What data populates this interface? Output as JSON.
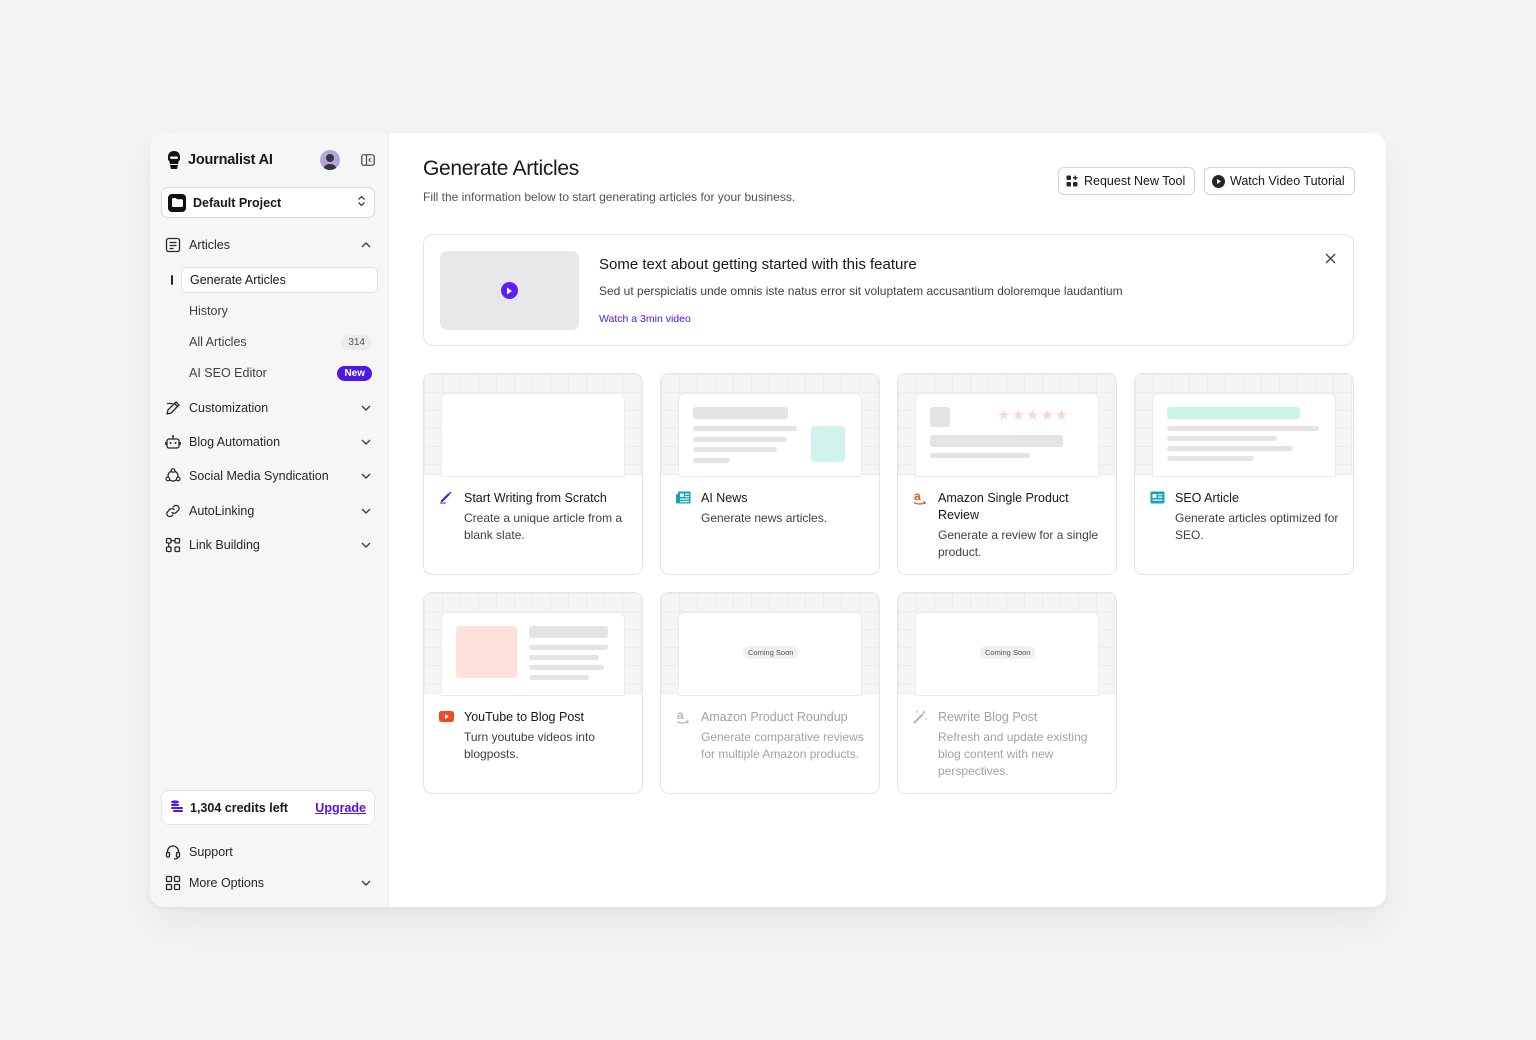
{
  "app": {
    "name": "Journalist AI"
  },
  "project": {
    "selected": "Default Project"
  },
  "sidebar": {
    "articles": {
      "label": "Articles",
      "items": [
        {
          "label": "Generate Articles"
        },
        {
          "label": "History"
        },
        {
          "label": "All Articles",
          "count": "314"
        },
        {
          "label": "AI SEO Editor",
          "badge": "New"
        }
      ]
    },
    "sections": [
      {
        "label": "Customization",
        "icon": "pen-tool-icon"
      },
      {
        "label": "Blog Automation",
        "icon": "robot-icon"
      },
      {
        "label": "Social Media Syndication",
        "icon": "share-icon"
      },
      {
        "label": "AutoLinking",
        "icon": "link-icon"
      },
      {
        "label": "Link Building",
        "icon": "nodes-icon"
      }
    ],
    "credits": {
      "text": "1,304 credits left",
      "upgrade": "Upgrade"
    },
    "footer": [
      {
        "label": "Support",
        "icon": "headset-icon"
      },
      {
        "label": "More Options",
        "icon": "grid-icon"
      }
    ]
  },
  "header": {
    "title": "Generate Articles",
    "subtitle": "Fill the information below to start generating articles for your business.",
    "request_tool": "Request New Tool",
    "watch_tutorial": "Watch Video Tutorial"
  },
  "banner": {
    "title": "Some text about getting started with this feature",
    "text": "Sed ut perspiciatis unde omnis iste natus error sit voluptatem accusantium doloremque laudantium",
    "link": "Watch a 3min video"
  },
  "tools": [
    {
      "title": "Start Writing from Scratch",
      "desc": "Create a unique article from a blank slate.",
      "icon": "pencil-icon"
    },
    {
      "title": "AI News",
      "desc": "Generate news articles.",
      "icon": "newspaper-icon"
    },
    {
      "title": "Amazon Single Product Review",
      "desc": "Generate a review for a single product.",
      "icon": "amazon-icon"
    },
    {
      "title": "SEO Article",
      "desc": "Generate articles optimized for SEO.",
      "icon": "seo-icon"
    },
    {
      "title": "YouTube to Blog Post",
      "desc": "Turn youtube videos into blogposts.",
      "icon": "youtube-icon"
    },
    {
      "title": "Amazon Product Roundup",
      "desc": "Generate comparative reviews for multiple Amazon products.",
      "icon": "amazon-icon",
      "badge": "Coming Soon"
    },
    {
      "title": "Rewrite Blog Post",
      "desc": "Refresh and update existing blog content with new perspectives.",
      "icon": "magic-wand-icon",
      "badge": "Coming Soon"
    }
  ],
  "colors": {
    "accent": "#4f17e8",
    "youtube": "#ef4b23",
    "amazon": "#e5541d",
    "teal": "#12a3b8"
  }
}
